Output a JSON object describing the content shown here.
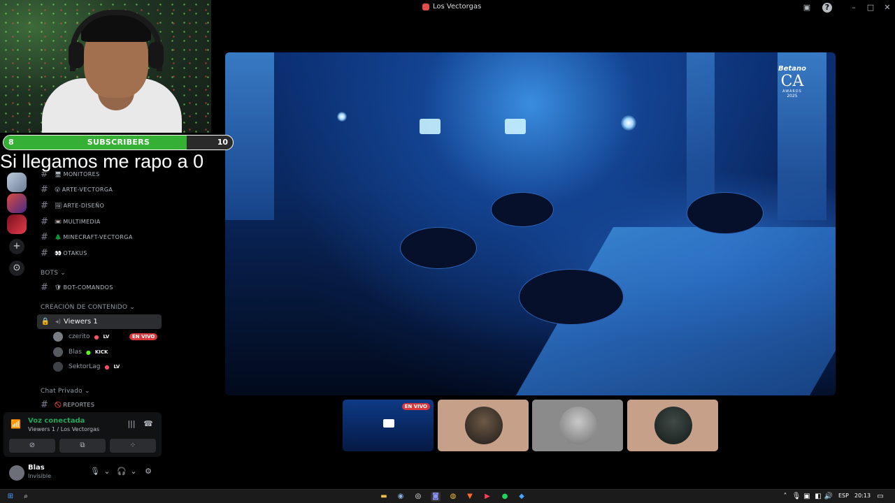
{
  "window": {
    "title": "Los Vectorgas"
  },
  "overlay": {
    "sub_current": "8",
    "sub_label": "SUBSCRIBERS",
    "sub_goal": "10",
    "sub_progress": 0.8,
    "caption": "Si llegamos me rapo a 0"
  },
  "sidebar": {
    "channels": [
      {
        "name": "MONITORES",
        "emoji": "🖥"
      },
      {
        "name": "ARTE-VECTORGA",
        "emoji": "😮"
      },
      {
        "name": "ARTE-DISEÑO",
        "emoji": "🖼"
      },
      {
        "name": "MULTIMEDIA",
        "emoji": "📼"
      },
      {
        "name": "MINECRAFT-VECTORGA",
        "emoji": "🌲"
      },
      {
        "name": "OTAKUS",
        "emoji": "👀"
      }
    ],
    "cat_bots": "BOTS",
    "bot_channel": {
      "name": "BOT-COMANDOS",
      "emoji": "🛡"
    },
    "cat_creacion": "CREACIÓN DE CONTENIDO",
    "voice_channel": "Viewers 1",
    "voice_users": [
      {
        "name": "czerito",
        "tag": "LV",
        "live": true
      },
      {
        "name": "Blas",
        "tag": "KICK",
        "live": false
      },
      {
        "name": "SektorLag",
        "tag": "LV",
        "live": false
      }
    ],
    "envivo": "EN VIVO",
    "cat_chat": "Chat Privado",
    "chat_channel": {
      "name": "REPORTES",
      "emoji": "🚫"
    }
  },
  "voice_panel": {
    "status": "Voz conectada",
    "location": "Viewers 1 / Los Vectorgas"
  },
  "user_panel": {
    "name": "Blas",
    "status": "Invisible"
  },
  "stream": {
    "award_brand": "Betano",
    "award_logo": "CA",
    "award_sub": "AWARDS",
    "award_year": "2025"
  },
  "tiles": {
    "envivo": "EN VIVO"
  },
  "taskbar": {
    "lang": "ESP",
    "time": "20:13"
  },
  "colors": {
    "green": "#23a55a",
    "live_red": "#da373c",
    "sub_green": "#35b035"
  },
  "icons": [
    "windows-icon",
    "search-icon",
    "explorer-icon",
    "steam-icon",
    "obs-icon",
    "discord-icon",
    "chrome-icon",
    "brave-icon",
    "youtube-icon",
    "spotify-icon",
    "app-icon"
  ]
}
